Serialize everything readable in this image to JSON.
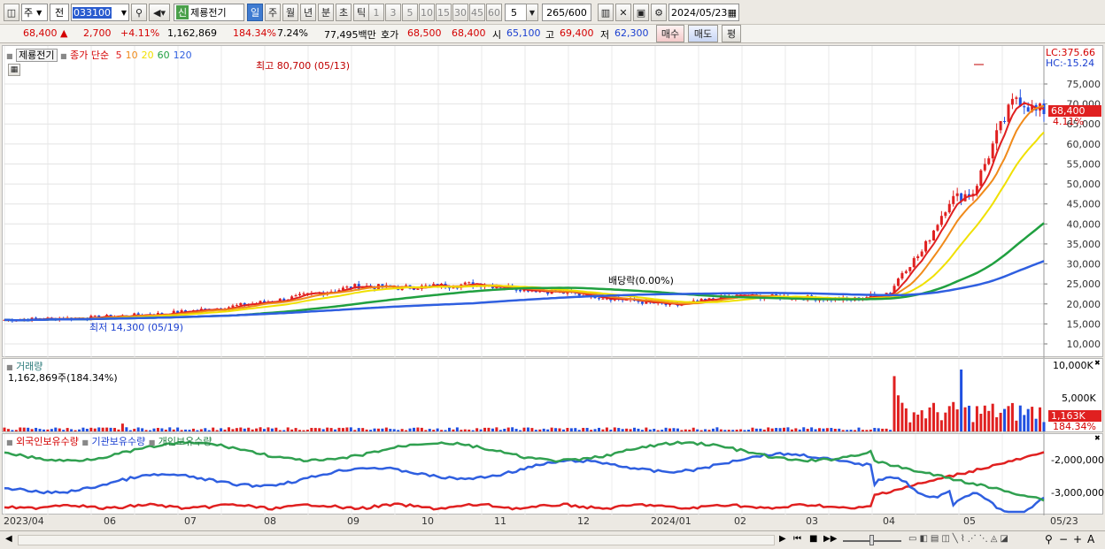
{
  "toolbar": {
    "period_type": "주",
    "adj": "전",
    "code": "033100",
    "stock_name": "제룡전기",
    "new_badge": "신",
    "periods": [
      "일",
      "주",
      "월",
      "년",
      "분",
      "초",
      "틱"
    ],
    "active_period": "일",
    "intervals": [
      "1",
      "3",
      "5",
      "10",
      "15",
      "30",
      "45",
      "60"
    ],
    "interval_value": "5",
    "count": "265",
    "count_total": "/600",
    "date": "2024/05/23"
  },
  "info": {
    "price": "68,400",
    "arrow": "▲",
    "change": "2,700",
    "change_pct": "+4.11%",
    "volume": "1,162,869",
    "vol_ratio": "184.34%",
    "turnover": "7.24%",
    "amount": "77,495백만",
    "bid_label": "호가",
    "ask_price": "68,500",
    "bid_price": "68,400",
    "open_label": "시",
    "open": "65,100",
    "high_label": "고",
    "high": "69,400",
    "low_label": "저",
    "low": "62,300",
    "buy_btn": "매수",
    "sell_btn": "매도",
    "eval_btn": "평"
  },
  "price_panel": {
    "name_tag": "제룡전기",
    "ma_label": "종가 단순",
    "ma_periods": [
      "5",
      "10",
      "20",
      "60",
      "120"
    ],
    "ma_colors": [
      "#e02020",
      "#f08a1a",
      "#f0e000",
      "#20a040",
      "#2f5fe0"
    ],
    "high_note": "최고 80,700 (05/13)",
    "low_note": "최저 14,300 (05/19)",
    "div_note": "배당락(0.00%)",
    "lc": "LC:375.66",
    "hc": "HC:-15.24",
    "last_price": "68,400",
    "last_pct": "4.11%",
    "y_ticks": [
      "75,000",
      "70,000",
      "65,000",
      "60,000",
      "55,000",
      "50,000",
      "45,000",
      "40,000",
      "35,000",
      "30,000",
      "25,000",
      "20,000",
      "15,000",
      "10,000"
    ]
  },
  "volume_panel": {
    "title": "거래량",
    "value": "1,162,869주(184.34%)",
    "y_ticks": [
      "10,000K",
      "5,000K"
    ],
    "last": "1,163K",
    "last_pct": "184.34%"
  },
  "holdings_panel": {
    "labels": [
      "외국인보유수량",
      "기관보유수량",
      "개인보유수량"
    ],
    "colors": [
      "#e02020",
      "#2f5fe0",
      "#30a050"
    ],
    "y_ticks": [
      "-2,000,000",
      "-3,000,000"
    ]
  },
  "x_axis": [
    "2023/04",
    "06",
    "07",
    "08",
    "09",
    "10",
    "11",
    "12",
    "2024/01",
    "02",
    "03",
    "04",
    "05",
    "05/23"
  ]
}
